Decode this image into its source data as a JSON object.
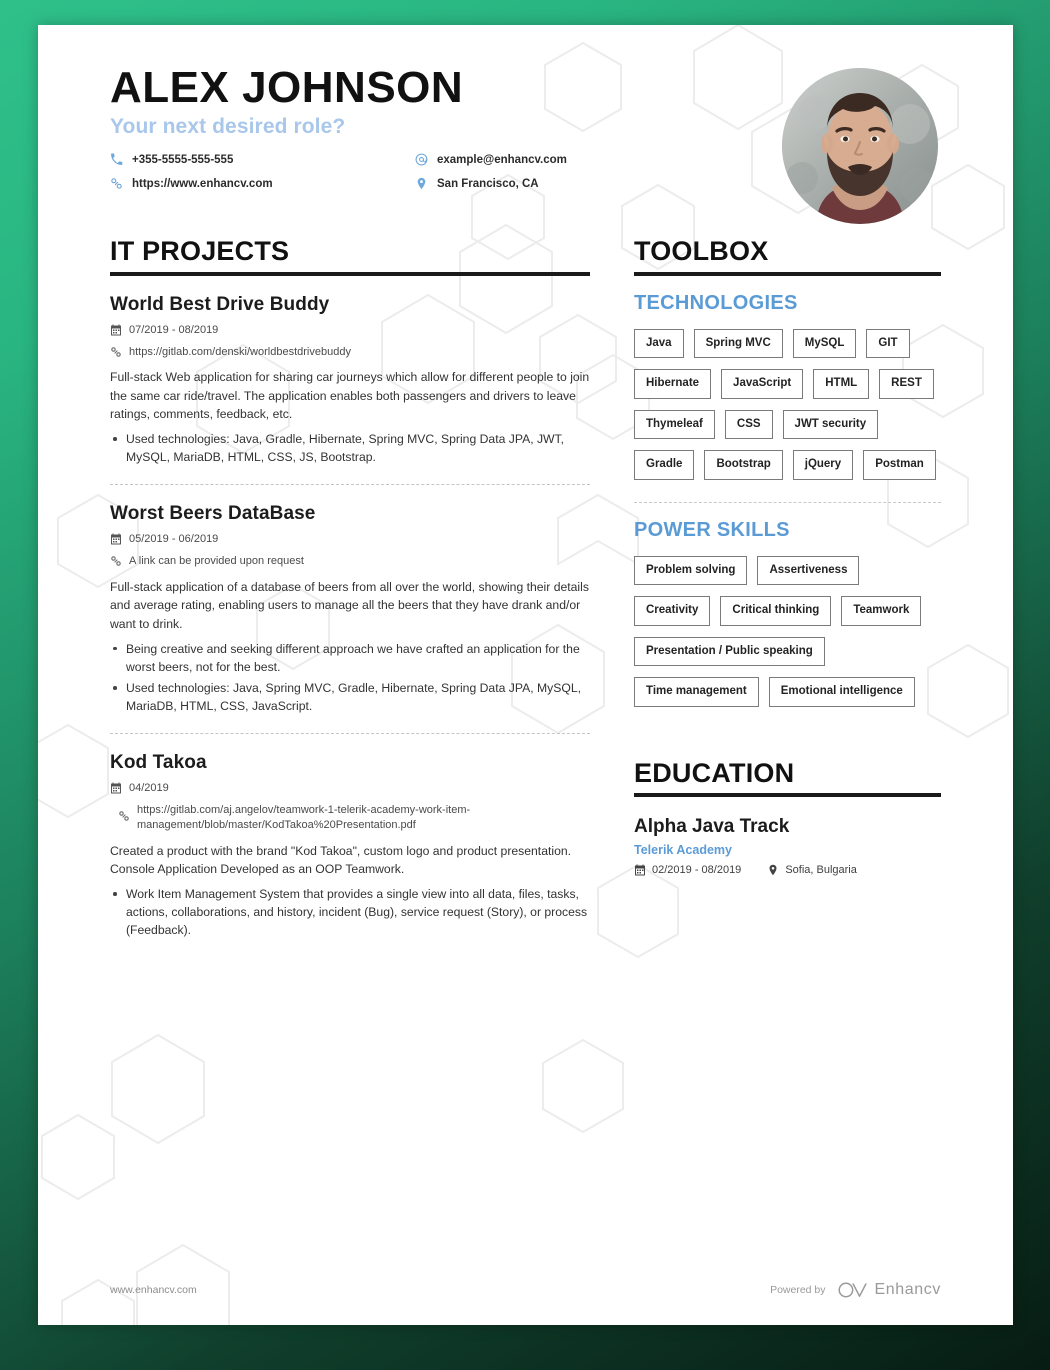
{
  "header": {
    "name": "ALEX JOHNSON",
    "role": "Your next desired role?",
    "contacts": [
      {
        "icon": "phone-icon",
        "text": "+355-5555-555-555"
      },
      {
        "icon": "email-icon",
        "text": "example@enhancv.com"
      },
      {
        "icon": "link-icon",
        "text": "https://www.enhancv.com"
      },
      {
        "icon": "location-icon",
        "text": "San Francisco, CA"
      }
    ]
  },
  "projects": {
    "heading": "IT PROJECTS",
    "items": [
      {
        "title": "World Best Drive Buddy",
        "date": "07/2019 - 08/2019",
        "link": "https://gitlab.com/denski/worldbestdrivebuddy",
        "description": "Full-stack Web application for sharing car journeys which allow for different people to join the same car ride/travel. The application enables both passengers and drivers to leave ratings, comments, feedback, etc.",
        "bullets": [
          "Used technologies: Java, Gradle, Hibernate, Spring MVC, Spring Data JPA, JWT, MySQL, MariaDB, HTML, CSS, JS, Bootstrap."
        ]
      },
      {
        "title": "Worst Beers DataBase",
        "date": "05/2019 - 06/2019",
        "link": "A link can be provided upon request",
        "description": "Full-stack application of a database of beers from all over the world, showing their details and average rating, enabling users to manage all the beers that they have drank and/or want to drink.",
        "bullets": [
          "Being creative and seeking different approach we have crafted an application for the worst beers, not for the best.",
          "Used technologies: Java, Spring MVC, Gradle, Hibernate, Spring Data JPA, MySQL, MariaDB, HTML, CSS, JavaScript."
        ]
      },
      {
        "title": "Kod Takoa",
        "date": "04/2019",
        "link": "https://gitlab.com/aj.angelov/teamwork-1-telerik-academy-work-item-management/blob/master/KodTakoa%20Presentation.pdf",
        "description": "Created a product with the brand \"Kod Takoa\", custom logo and product presentation. Console Application Developed as an OOP Teamwork.",
        "bullets": [
          "Work Item Management System that provides a single view into all data, files, tasks, actions, collaborations, and history, incident (Bug), service request (Story), or process (Feedback)."
        ]
      }
    ]
  },
  "toolbox": {
    "heading": "TOOLBOX",
    "technologies": {
      "subheading": "TECHNOLOGIES",
      "tags": [
        "Java",
        "Spring MVC",
        "MySQL",
        "GIT",
        "Hibernate",
        "JavaScript",
        "HTML",
        "REST",
        "Thymeleaf",
        "CSS",
        "JWT security",
        "Gradle",
        "Bootstrap",
        "jQuery",
        "Postman"
      ]
    },
    "power_skills": {
      "subheading": "POWER SKILLS",
      "tags": [
        "Problem solving",
        "Assertiveness",
        "Creativity",
        "Critical thinking",
        "Teamwork",
        "Presentation / Public speaking",
        "Time management",
        "Emotional intelligence"
      ]
    }
  },
  "education": {
    "heading": "EDUCATION",
    "items": [
      {
        "title": "Alpha Java Track",
        "organization": "Telerik Academy",
        "date": "02/2019 - 08/2019",
        "location": "Sofia, Bulgaria"
      }
    ]
  },
  "footer": {
    "website": "www.enhancv.com",
    "powered_by": "Powered by",
    "brand": "Enhancv"
  },
  "colors": {
    "accent_blue": "#5b9bd5",
    "light_blue": "#a9c7ea",
    "page_border_green": "#2fc08a",
    "text_dark": "#1c1c1c"
  }
}
